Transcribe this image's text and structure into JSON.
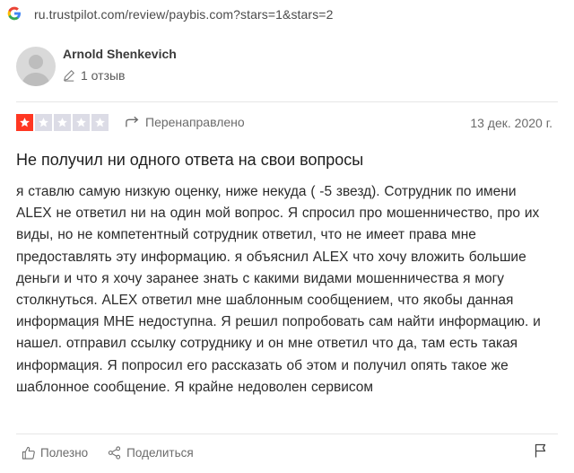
{
  "url": {
    "text": "ru.trustpilot.com/review/paybis.com?stars=1&stars=2",
    "icon": "google-g-icon"
  },
  "reviewer": {
    "name": "Arnold Shenkevich",
    "reviews_count": "1 отзыв",
    "avatar_icon": "avatar-placeholder-icon"
  },
  "rating": {
    "stars": 1,
    "max": 5,
    "color_on": "#ff3722",
    "color_off": "#dcdce6"
  },
  "status": {
    "label": "Перенаправлено",
    "icon": "redirect-arrow-icon"
  },
  "date": "13 дек. 2020 г.",
  "review": {
    "title": "Не получил ни одного ответа на свои вопросы",
    "body": "я ставлю самую низкую оценку, ниже некуда ( -5 звезд). Сотрудник по имени ALEX не ответил ни на один мой вопрос. Я спросил про мошенничество, про их виды, но не компетентный сотрудник ответил, что не имеет права мне предоставлять эту информацию. я объяснил ALEX что хочу вложить большие деньги и что я хочу заранее знать с какими видами мошенничества я могу столкнуться. ALEX ответил мне шаблонным сообщением, что якобы данная информация МНЕ недоступна. Я решил попробовать сам найти информацию. и нашел. отправил ссылку сотруднику и он мне ответил что да, там есть такая информация. Я попросил его рассказать об этом и получил опять такое же шаблонное сообщение. Я крайне недоволен сервисом"
  },
  "actions": {
    "useful_label": "Полезно",
    "share_label": "Поделиться",
    "useful_icon": "thumbs-up-icon",
    "share_icon": "share-icon",
    "flag_icon": "flag-icon"
  }
}
